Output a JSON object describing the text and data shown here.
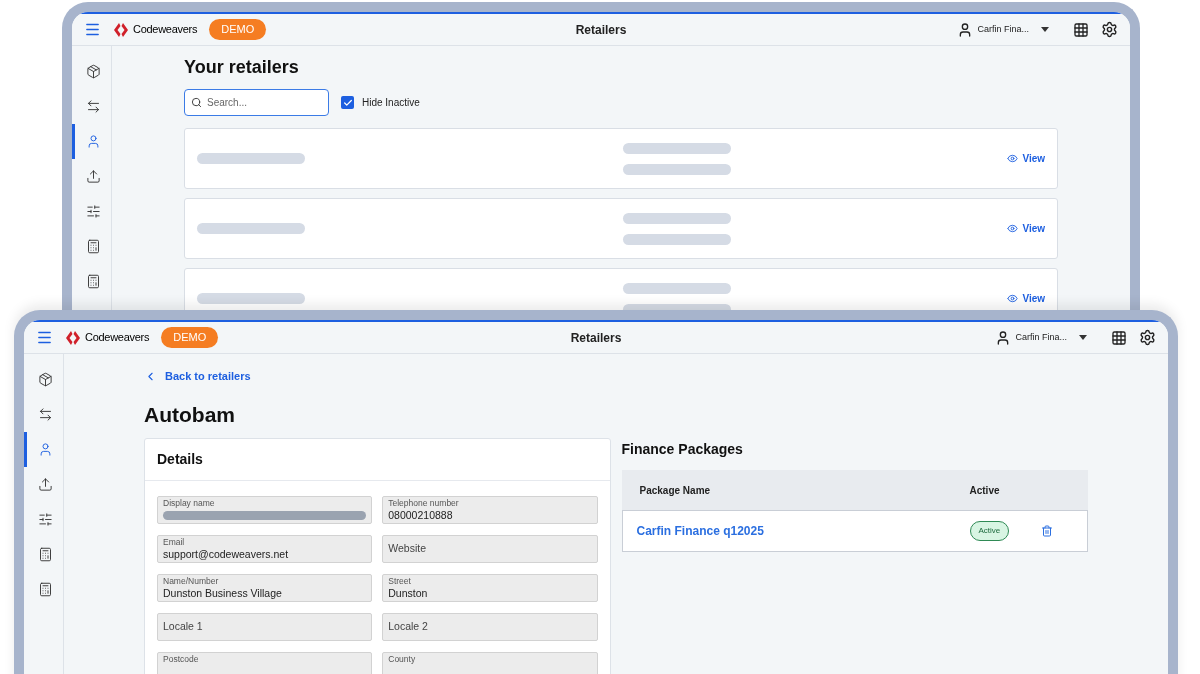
{
  "windows": [
    {
      "kind": "list",
      "header": {
        "brand": "Codeweavers",
        "badge": "DEMO",
        "title": "Retailers",
        "user": "Carfin Fina..."
      },
      "sidebar": {
        "items": [
          {
            "selected": false
          },
          {
            "selected": false
          },
          {
            "selected": true
          },
          {
            "selected": false
          },
          {
            "selected": false
          },
          {
            "selected": false
          },
          {
            "selected": false
          }
        ]
      },
      "page": {
        "title": "Your retailers",
        "search": {
          "placeholder": "Search..."
        },
        "hide_inactive": {
          "label": "Hide Inactive",
          "checked": true
        },
        "retailers": [
          {
            "loading": true,
            "action": "View"
          },
          {
            "loading": true,
            "action": "View"
          },
          {
            "loading": true,
            "action": "View"
          }
        ]
      }
    },
    {
      "kind": "detail",
      "header": {
        "brand": "Codeweavers",
        "badge": "DEMO",
        "title": "Retailers",
        "user": "Carfin Fina..."
      },
      "sidebar": {
        "items": [
          {
            "selected": false
          },
          {
            "selected": false
          },
          {
            "selected": true
          },
          {
            "selected": false
          },
          {
            "selected": false
          },
          {
            "selected": false
          },
          {
            "selected": false
          }
        ]
      },
      "page": {
        "back_link": "Back to retailers",
        "title": "Autobam",
        "details": {
          "title": "Details",
          "fields": [
            {
              "kind": "redacted",
              "label": "Display name"
            },
            {
              "kind": "filled",
              "label": "Telephone number",
              "value": "08000210888"
            },
            {
              "kind": "filled",
              "label": "Email",
              "value": "support@codeweavers.net"
            },
            {
              "kind": "empty",
              "placeholder": "Website"
            },
            {
              "kind": "filled",
              "label": "Name/Number",
              "value": "Dunston Business Village"
            },
            {
              "kind": "filled",
              "label": "Street",
              "value": "Dunston"
            },
            {
              "kind": "empty",
              "placeholder": "Locale 1"
            },
            {
              "kind": "empty",
              "placeholder": "Locale 2"
            },
            {
              "kind": "filled",
              "label": "Postcode"
            },
            {
              "kind": "filled",
              "label": "County"
            }
          ]
        },
        "finance": {
          "title": "Finance Packages",
          "columns": [
            "Package Name",
            "Active"
          ],
          "rows": [
            {
              "name": "Carfin Finance q12025",
              "status": "Active",
              "active": true
            }
          ]
        }
      }
    }
  ]
}
